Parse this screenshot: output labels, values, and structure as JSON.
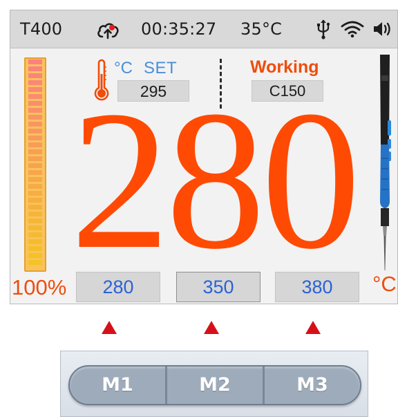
{
  "status_bar": {
    "model": "T400",
    "time": "00:35:27",
    "ambient_temp": "35°C",
    "icons": [
      "cloud-upload-icon",
      "usb-icon",
      "wifi-icon",
      "speaker-icon"
    ]
  },
  "power": {
    "percent_label": "100%",
    "level": 1.0
  },
  "setpoint": {
    "unit": "°C",
    "label": "SET",
    "value": "295"
  },
  "mode": {
    "status": "Working",
    "value": "C150"
  },
  "current_temp": "280",
  "presets": [
    "280",
    "350",
    "380"
  ],
  "unit_large": "°C",
  "memory_buttons": [
    "M1",
    "M2",
    "M3"
  ],
  "colors": {
    "accent_orange": "#ff4a04",
    "preset_blue": "#2a62d6",
    "set_blue": "#4a8fd8",
    "marker_red": "#d6101a"
  }
}
